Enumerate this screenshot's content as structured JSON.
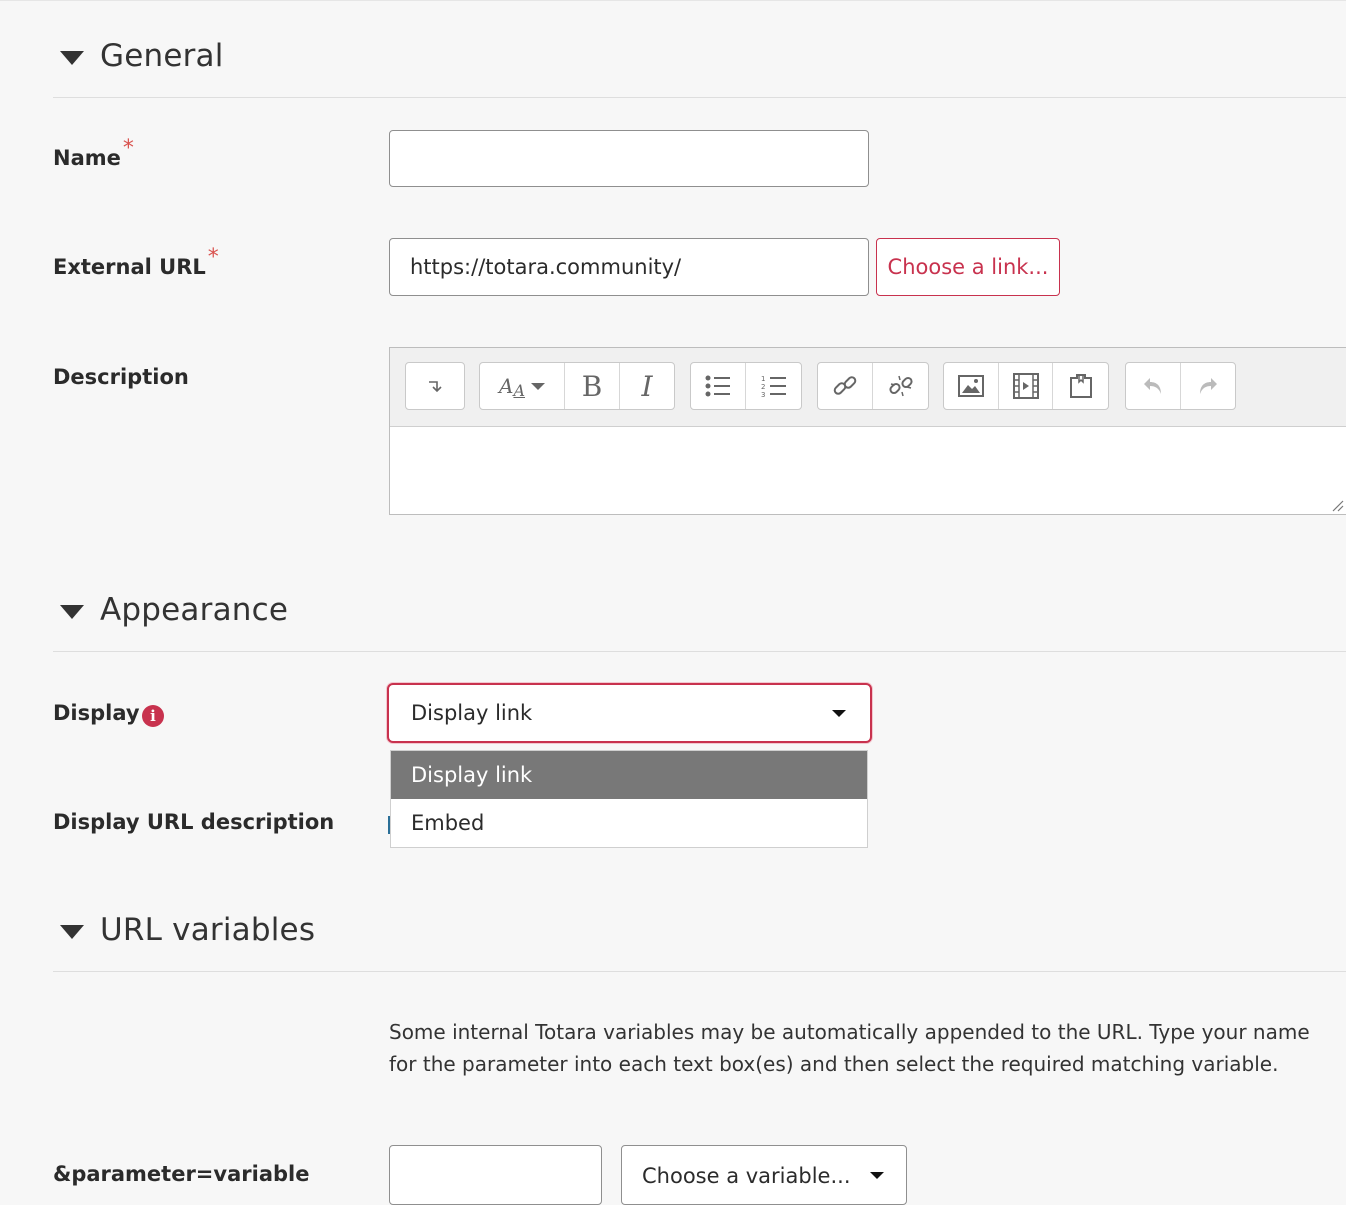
{
  "sections": {
    "general": {
      "title": "General"
    },
    "appearance": {
      "title": "Appearance"
    },
    "url_variables": {
      "title": "URL variables"
    }
  },
  "form": {
    "name": {
      "label": "Name",
      "required_mark": "*",
      "value": ""
    },
    "external_url": {
      "label": "External URL",
      "required_mark": "*",
      "value": "https://totara.community/",
      "choose_link_label": "Choose a link..."
    },
    "description": {
      "label": "Description",
      "toolbar": {
        "groups": [
          [
            "collapse-icon"
          ],
          [
            "font-size-icon",
            "bold-icon",
            "italic-icon"
          ],
          [
            "unordered-list-icon",
            "ordered-list-icon"
          ],
          [
            "link-icon",
            "unlink-icon"
          ],
          [
            "image-icon",
            "media-icon",
            "manage-files-icon"
          ],
          [
            "undo-icon",
            "redo-icon"
          ]
        ],
        "bold_glyph": "B",
        "italic_glyph": "I",
        "font_glyph": "A"
      },
      "value": ""
    },
    "display": {
      "label": "Display",
      "info_icon": "i",
      "selected": "Display link",
      "options": [
        "Display link",
        "Embed"
      ]
    },
    "display_url_description": {
      "label": "Display URL description"
    },
    "url_variables_help": "Some internal Totara variables may be automatically appended to the URL. Type your name for the parameter into each text box(es) and then select the required matching variable.",
    "parameter": {
      "label": "&parameter=variable",
      "value": "",
      "variable_placeholder": "Choose a variable..."
    }
  },
  "colors": {
    "accent": "#c8324e",
    "selected_option_bg": "#787878",
    "page_bg": "#f7f7f7"
  }
}
